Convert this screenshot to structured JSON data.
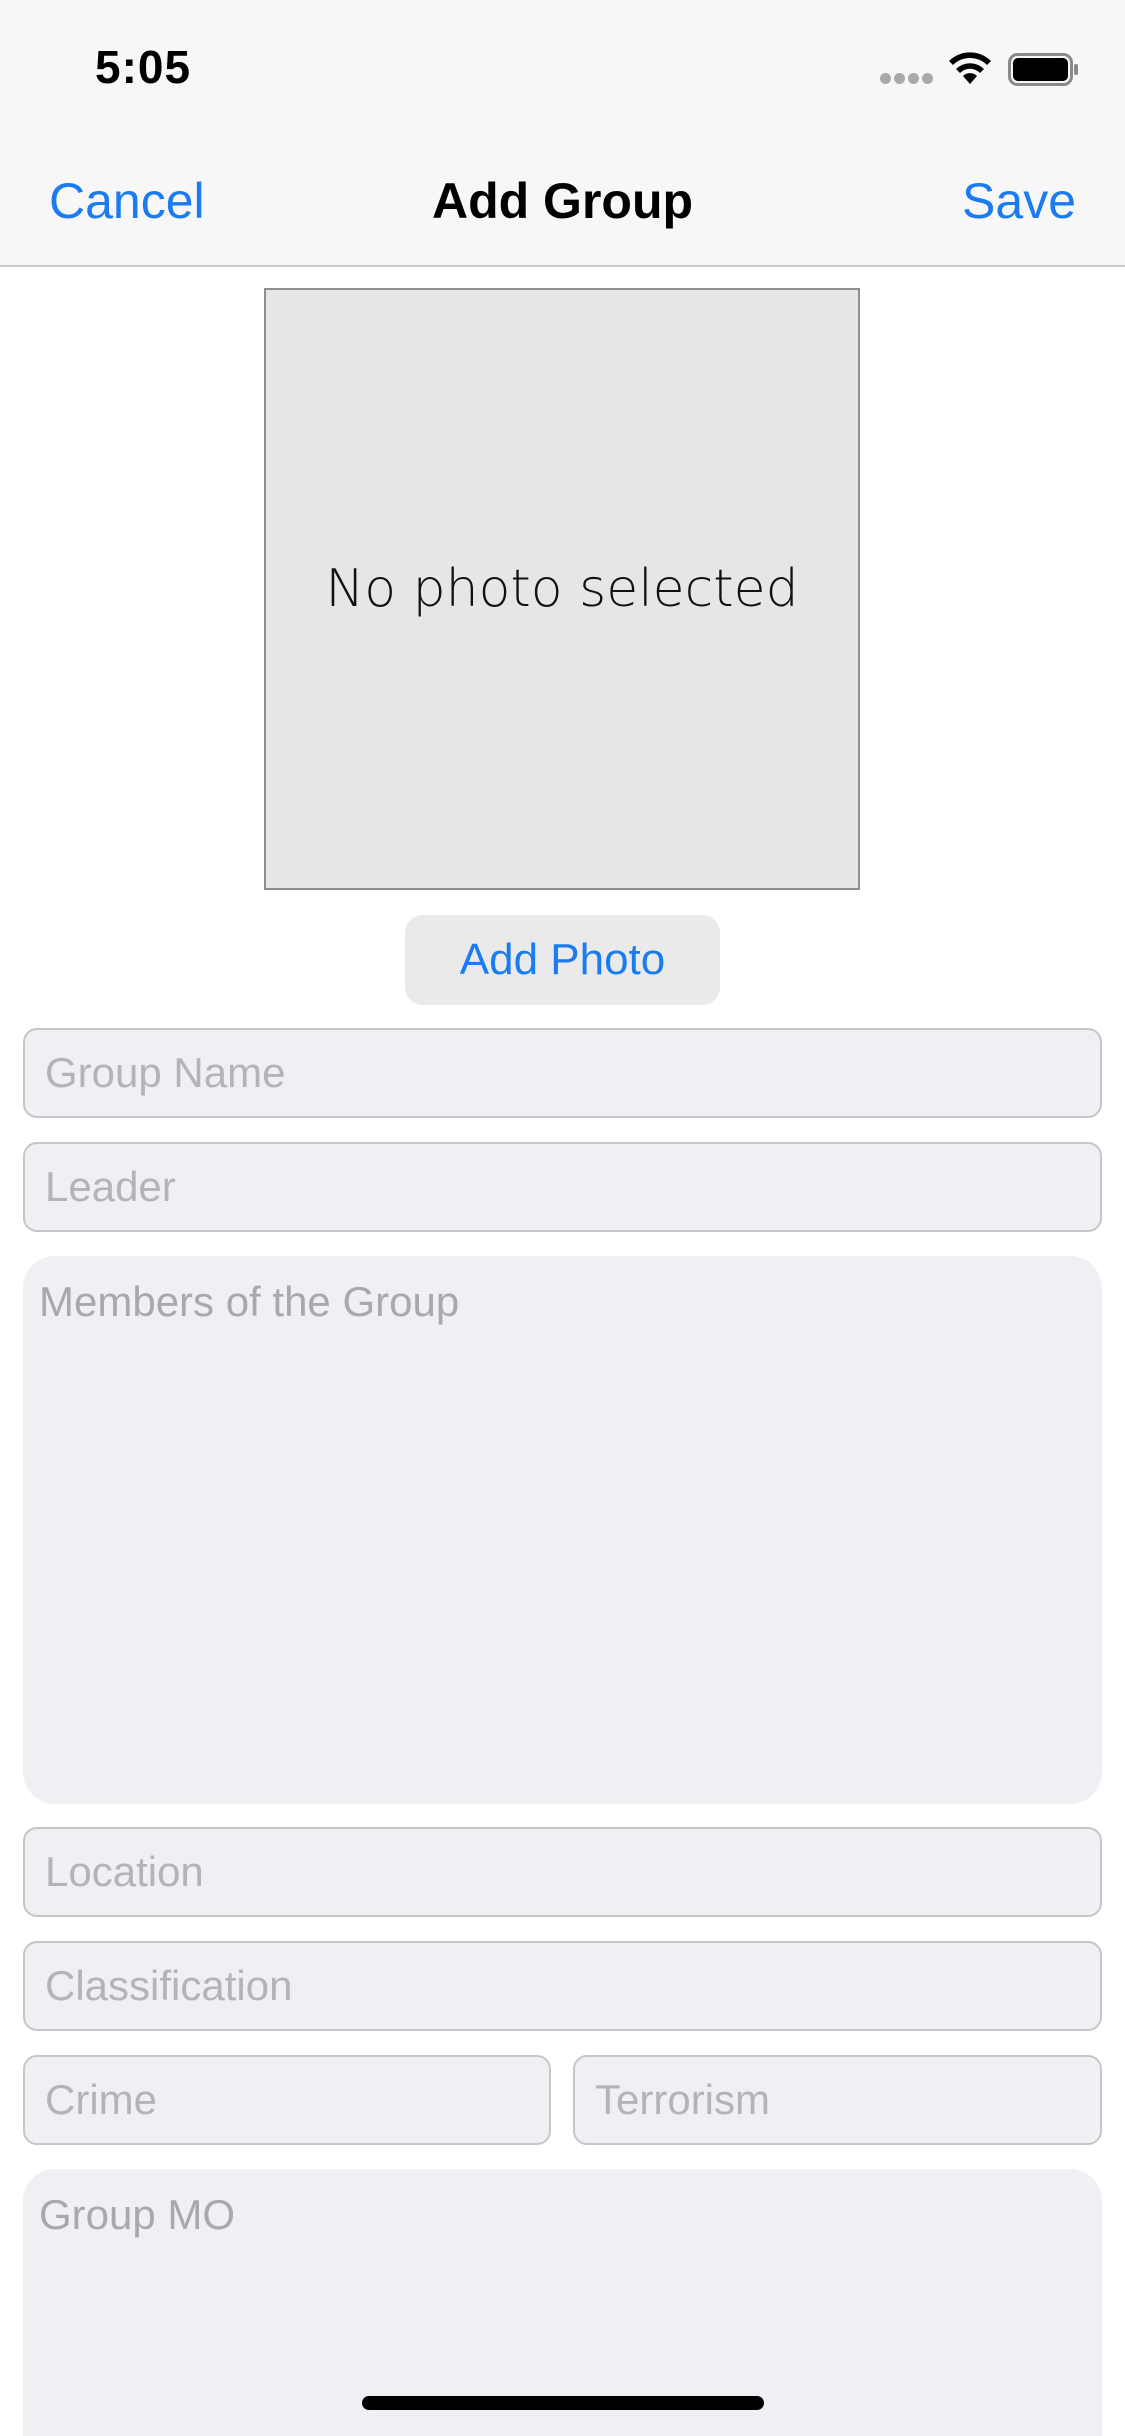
{
  "status_bar": {
    "time": "5:05",
    "icons": [
      "cellular-signal-icon",
      "wifi-icon",
      "battery-icon"
    ]
  },
  "nav": {
    "cancel_label": "Cancel",
    "title": "Add Group",
    "save_label": "Save"
  },
  "photo": {
    "placeholder_text": "No photo selected",
    "add_photo_label": "Add Photo"
  },
  "form": {
    "group_name_placeholder": "Group Name",
    "leader_placeholder": "Leader",
    "members_placeholder": "Members of the Group",
    "location_placeholder": "Location",
    "classification_placeholder": "Classification",
    "crime_placeholder": "Crime",
    "terrorism_placeholder": "Terrorism",
    "group_mo_placeholder": "Group MO"
  },
  "colors": {
    "accent": "#1a7cf0",
    "field_bg": "#efeff4",
    "bar_bg": "#f7f7f7",
    "photo_bg": "#e5e6e6"
  }
}
